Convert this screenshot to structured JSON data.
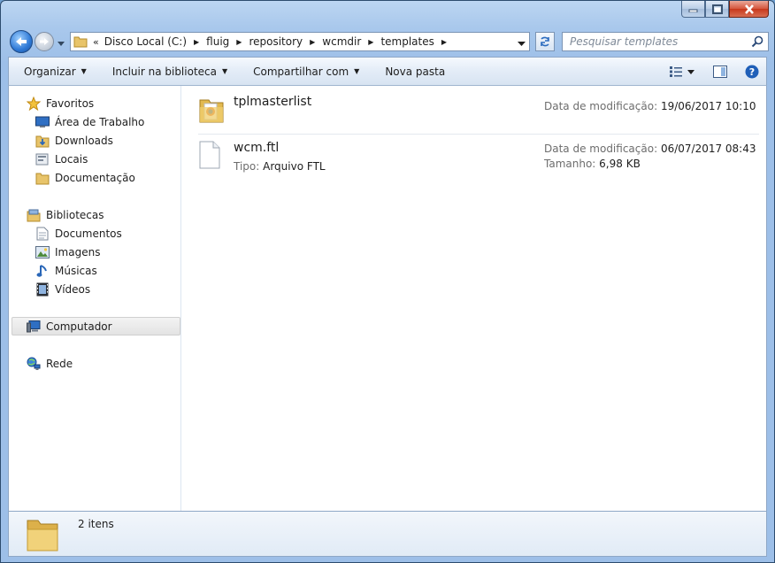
{
  "window": {
    "minimize_icon": "minimize-icon",
    "maximize_icon": "maximize-icon",
    "close_icon": "close-icon"
  },
  "address": {
    "lead": "«",
    "crumbs": [
      "Disco Local (C:)",
      "fluig",
      "repository",
      "wcmdir",
      "templates"
    ]
  },
  "search": {
    "placeholder": "Pesquisar templates"
  },
  "toolbar": {
    "organize": "Organizar",
    "include_library": "Incluir na biblioteca",
    "share": "Compartilhar com",
    "new_folder": "Nova pasta"
  },
  "sidebar": {
    "favorites": {
      "label": "Favoritos",
      "items": [
        {
          "label": "Área de Trabalho",
          "icon": "desktop-icon"
        },
        {
          "label": "Downloads",
          "icon": "downloads-folder-icon"
        },
        {
          "label": "Locais",
          "icon": "recent-places-icon"
        },
        {
          "label": "Documentação",
          "icon": "folder-icon"
        }
      ]
    },
    "libraries": {
      "label": "Bibliotecas",
      "items": [
        {
          "label": "Documentos",
          "icon": "document-icon"
        },
        {
          "label": "Imagens",
          "icon": "image-icon"
        },
        {
          "label": "Músicas",
          "icon": "music-icon"
        },
        {
          "label": "Vídeos",
          "icon": "video-icon"
        }
      ]
    },
    "computer": {
      "label": "Computador"
    },
    "network": {
      "label": "Rede"
    }
  },
  "files": [
    {
      "name": "tplmasterlist",
      "icon": "folder-icon",
      "modified_label": "Data de modificação:",
      "modified_value": "19/06/2017 10:10"
    },
    {
      "name": "wcm.ftl",
      "icon": "file-icon",
      "type_label": "Tipo:",
      "type_value": "Arquivo FTL",
      "modified_label": "Data de modificação:",
      "modified_value": "06/07/2017 08:43",
      "size_label": "Tamanho:",
      "size_value": "6,98 KB"
    }
  ],
  "status": {
    "count": "2 itens"
  }
}
